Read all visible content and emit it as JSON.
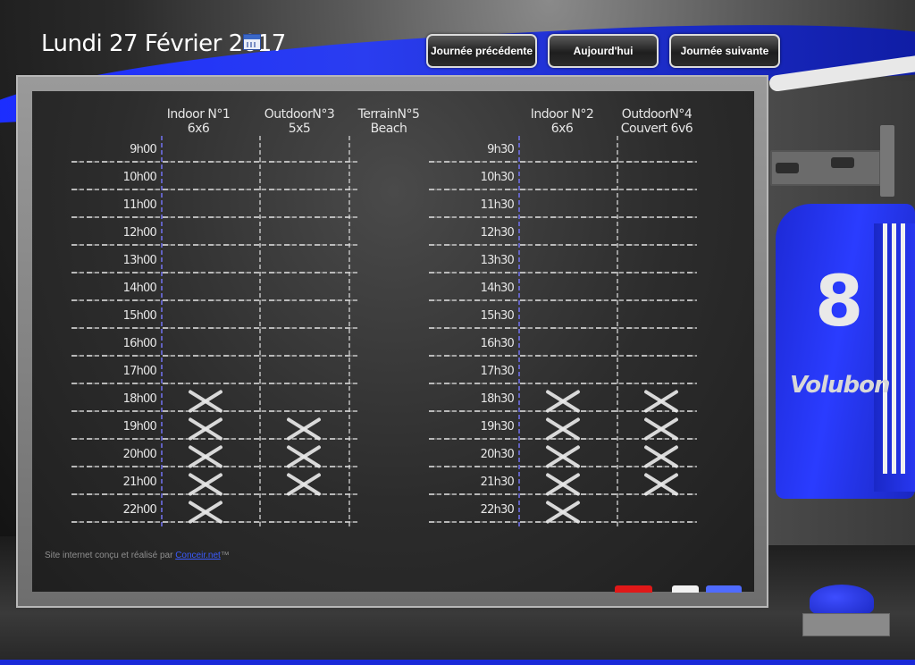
{
  "header": {
    "date_title": "Lundi 27 Février 2017",
    "prev_label": "Journée précédente",
    "today_label": "Aujourd'hui",
    "next_label": "Journée suivante"
  },
  "left_group": {
    "courts": [
      {
        "line1": "Indoor N°1",
        "line2": "6x6"
      },
      {
        "line1": "OutdoorN°3",
        "line2": "5x5"
      },
      {
        "line1": "TerrainN°5",
        "line2": "Beach"
      }
    ],
    "times": [
      "9h00",
      "10h00",
      "11h00",
      "12h00",
      "13h00",
      "14h00",
      "15h00",
      "16h00",
      "17h00",
      "18h00",
      "19h00",
      "20h00",
      "21h00",
      "22h00"
    ],
    "booked": [
      [
        false,
        false,
        false,
        false,
        false,
        false,
        false,
        false,
        false,
        true,
        true,
        true,
        true,
        true
      ],
      [
        false,
        false,
        false,
        false,
        false,
        false,
        false,
        false,
        false,
        false,
        true,
        true,
        true,
        false
      ],
      [
        false,
        false,
        false,
        false,
        false,
        false,
        false,
        false,
        false,
        false,
        false,
        false,
        false,
        false
      ]
    ]
  },
  "right_group": {
    "courts": [
      {
        "line1": "Indoor N°2",
        "line2": "6x6"
      },
      {
        "line1": "OutdoorN°4",
        "line2": "Couvert 6v6"
      }
    ],
    "times": [
      "9h30",
      "10h30",
      "11h30",
      "12h30",
      "13h30",
      "14h30",
      "15h30",
      "16h30",
      "17h30",
      "18h30",
      "19h30",
      "20h30",
      "21h30",
      "22h30"
    ],
    "booked": [
      [
        false,
        false,
        false,
        false,
        false,
        false,
        false,
        false,
        false,
        true,
        true,
        true,
        true,
        true
      ],
      [
        false,
        false,
        false,
        false,
        false,
        false,
        false,
        false,
        false,
        true,
        true,
        true,
        true,
        false
      ]
    ]
  },
  "footer": {
    "prefix": "Site internet conçu et réalisé par ",
    "link_text": "Conceir.net",
    "suffix": "™"
  },
  "jersey": {
    "number": "8",
    "logo": "Volubon"
  },
  "colors": {
    "brand_blue": "#1b2cff",
    "chalk": "#e6e6e6",
    "board": "#2c2c2c"
  },
  "icons": {
    "calendar": "calendar-icon",
    "booked_mark": "cross-mark-icon"
  }
}
